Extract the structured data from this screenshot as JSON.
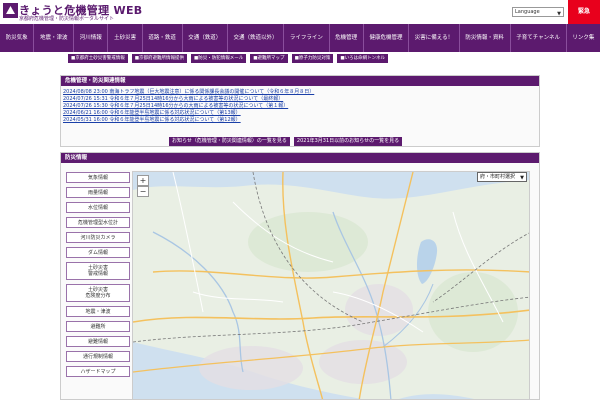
{
  "header": {
    "title": "きょうと危機管理 WEB",
    "subtitle": "京都府危機管理・防災情報ポータルサイト",
    "language_label": "Language",
    "emergency_label": "緊急"
  },
  "nav": [
    "防災気象",
    "地震・津波",
    "河川情報",
    "土砂災害",
    "道路・鉄道",
    "交通（鉄道）",
    "交通（鉄道以外）",
    "ライフライン",
    "危機管理",
    "健康危機管理",
    "災害に備える！",
    "防災情報・資料",
    "子育てチャンネル",
    "リンク集"
  ],
  "toolbar": [
    "■京都府土砂災害警戒情報",
    "■京都府避難所情報提供",
    "■防災・防犯情報メール",
    "■避難所マップ",
    "■原子力防災対策",
    "■いろは命綱トンネル"
  ],
  "news": {
    "title": "危機管理・防災関連情報",
    "items": [
      "2024/08/08 23:00 南海トラフ地震（巨大地震注意）に係る関係課長会議の開催について（令和６年８月８日）",
      "2024/07/26 15:31 令和６年７月25日14時16分から大雨による被害等の状況について（最終報）",
      "2024/07/26 15:30 令和６年７月25日14時16分からの大雨による被害等の状況について（第１報）",
      "2024/06/21 16:00 令和６年能登半島地震に係る対応状況について（第13報）",
      "2024/05/31 16:00 令和６年能登半島地震に係る対応状況について（第12報）"
    ],
    "btn_list": "お知らせ（危機管理・防災関連情報）の一覧を見る",
    "btn_archive": "2021年3月31日以前のお知らせの一覧を見る"
  },
  "disaster": {
    "title": "防災情報",
    "side": [
      "気象情報",
      "雨量情報",
      "水位情報",
      "危機管理型水位計",
      "河川防災カメラ",
      "ダム情報",
      "土砂災害\n警戒情報",
      "土砂災害\n危険度分布",
      "地震・津波",
      "避難所",
      "避難情報",
      "通行規制情報",
      "ハザードマップ"
    ],
    "region_select": "府・市町村選択"
  },
  "colors": {
    "accent": "#5c1a6e",
    "emergency": "#e8001c",
    "link": "#1a3fa8"
  }
}
